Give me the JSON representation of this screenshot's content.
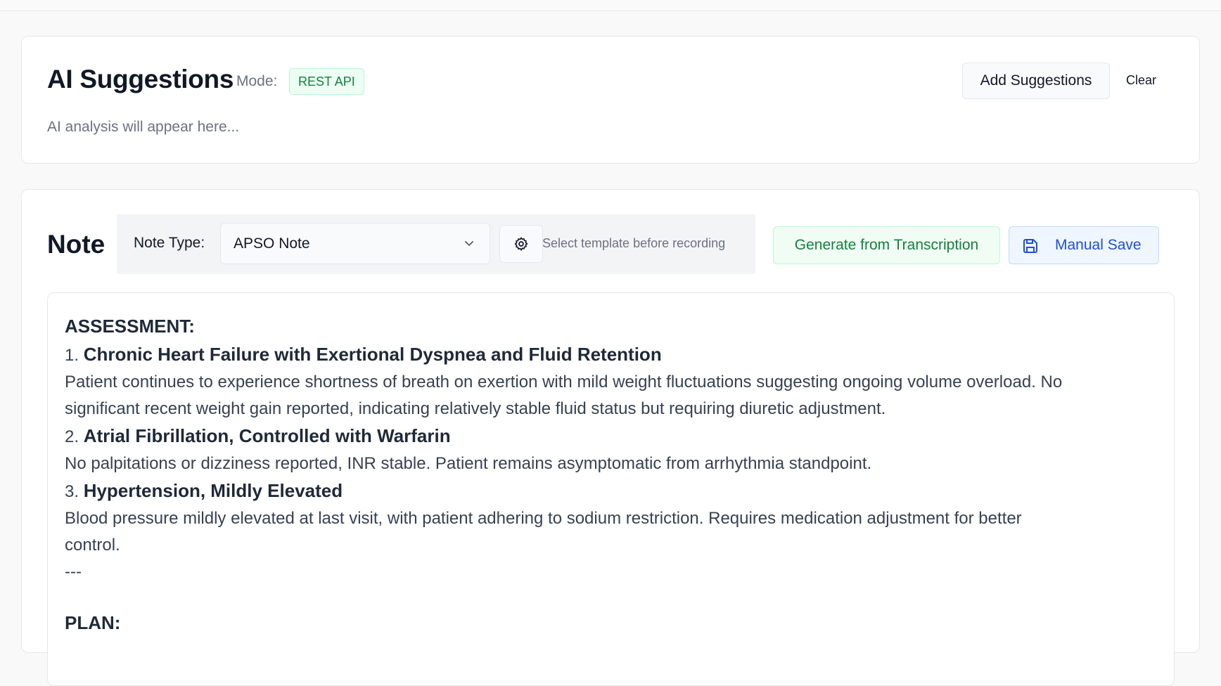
{
  "ai_panel": {
    "title": "AI Suggestions",
    "mode_label": "Mode:",
    "mode_badge": "REST API",
    "add_button": "Add Suggestions",
    "clear_button": "Clear",
    "placeholder": "AI analysis will appear here..."
  },
  "note_panel": {
    "title": "Note",
    "note_type_label": "Note Type:",
    "note_type_value": "APSO Note",
    "template_hint": "Select template before recording",
    "generate_button": "Generate from Transcription",
    "save_button": "Manual Save",
    "content": {
      "assessment_heading": "ASSESSMENT:",
      "items": [
        {
          "number": "1.",
          "title": "Chronic Heart Failure with Exertional Dyspnea and Fluid Retention",
          "line1": "Patient continues to experience shortness of breath on exertion with mild weight fluctuations suggesting ongoing volume overload. No",
          "line2": "significant recent weight gain reported, indicating relatively stable fluid status but requiring diuretic adjustment."
        },
        {
          "number": "2.",
          "title": "Atrial Fibrillation, Controlled with Warfarin",
          "line1": "No palpitations or dizziness reported, INR stable. Patient remains asymptomatic from arrhythmia standpoint.",
          "line2": ""
        },
        {
          "number": "3.",
          "title": "Hypertension, Mildly Elevated",
          "line1": "Blood pressure mildly elevated at last visit, with patient adhering to sodium restriction. Requires medication adjustment for better",
          "line2": "control."
        }
      ],
      "separator": "---",
      "plan_heading": "PLAN:"
    }
  },
  "icons": {
    "select_chevron": "chevron-down-icon",
    "settings": "gear-icon",
    "save": "save-icon"
  },
  "colors": {
    "mode_badge_text": "#15803d",
    "generate_text": "#15803d",
    "save_text": "#1d4ed8"
  }
}
